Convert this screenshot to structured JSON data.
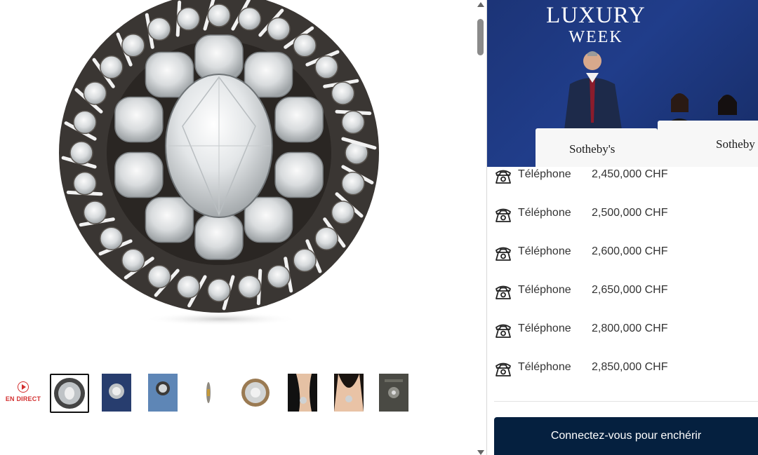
{
  "live": {
    "label": "EN DIRECT",
    "icon": "play-circle-icon"
  },
  "thumbnails": [
    {
      "name": "thumbnail-1",
      "selected": true
    },
    {
      "name": "thumbnail-2",
      "selected": false
    },
    {
      "name": "thumbnail-3",
      "selected": false
    },
    {
      "name": "thumbnail-4",
      "selected": false
    },
    {
      "name": "thumbnail-5",
      "selected": false
    },
    {
      "name": "thumbnail-6",
      "selected": false
    },
    {
      "name": "thumbnail-7",
      "selected": false
    },
    {
      "name": "thumbnail-8",
      "selected": false
    }
  ],
  "video": {
    "title_line1": "LUXURY",
    "title_line2": "WEEK",
    "desk_logo_1": "Sotheby's",
    "desk_logo_2": "Sotheby"
  },
  "bids": [
    {
      "bidder": "Téléphone",
      "amount": "2,450,000 CHF",
      "icon": "telephone-icon"
    },
    {
      "bidder": "Téléphone",
      "amount": "2,500,000 CHF",
      "icon": "telephone-icon"
    },
    {
      "bidder": "Téléphone",
      "amount": "2,600,000 CHF",
      "icon": "telephone-icon"
    },
    {
      "bidder": "Téléphone",
      "amount": "2,650,000 CHF",
      "icon": "telephone-icon"
    },
    {
      "bidder": "Téléphone",
      "amount": "2,800,000 CHF",
      "icon": "telephone-icon"
    },
    {
      "bidder": "Téléphone",
      "amount": "2,850,000 CHF",
      "icon": "telephone-icon"
    }
  ],
  "cta": {
    "label": "Connectez-vous pour enchérir"
  },
  "colors": {
    "live_red": "#d32f2f",
    "cta_navy": "#05203f",
    "video_blue": "#1c3477"
  }
}
